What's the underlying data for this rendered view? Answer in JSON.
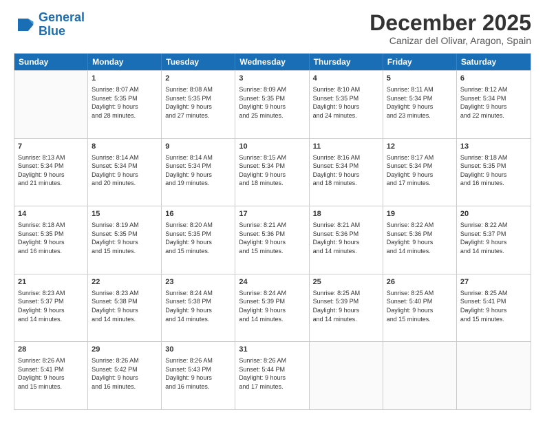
{
  "logo": {
    "line1": "General",
    "line2": "Blue"
  },
  "title": "December 2025",
  "location": "Canizar del Olivar, Aragon, Spain",
  "header_days": [
    "Sunday",
    "Monday",
    "Tuesday",
    "Wednesday",
    "Thursday",
    "Friday",
    "Saturday"
  ],
  "weeks": [
    [
      {
        "day": "",
        "info": ""
      },
      {
        "day": "1",
        "info": "Sunrise: 8:07 AM\nSunset: 5:35 PM\nDaylight: 9 hours\nand 28 minutes."
      },
      {
        "day": "2",
        "info": "Sunrise: 8:08 AM\nSunset: 5:35 PM\nDaylight: 9 hours\nand 27 minutes."
      },
      {
        "day": "3",
        "info": "Sunrise: 8:09 AM\nSunset: 5:35 PM\nDaylight: 9 hours\nand 25 minutes."
      },
      {
        "day": "4",
        "info": "Sunrise: 8:10 AM\nSunset: 5:35 PM\nDaylight: 9 hours\nand 24 minutes."
      },
      {
        "day": "5",
        "info": "Sunrise: 8:11 AM\nSunset: 5:34 PM\nDaylight: 9 hours\nand 23 minutes."
      },
      {
        "day": "6",
        "info": "Sunrise: 8:12 AM\nSunset: 5:34 PM\nDaylight: 9 hours\nand 22 minutes."
      }
    ],
    [
      {
        "day": "7",
        "info": "Sunrise: 8:13 AM\nSunset: 5:34 PM\nDaylight: 9 hours\nand 21 minutes."
      },
      {
        "day": "8",
        "info": "Sunrise: 8:14 AM\nSunset: 5:34 PM\nDaylight: 9 hours\nand 20 minutes."
      },
      {
        "day": "9",
        "info": "Sunrise: 8:14 AM\nSunset: 5:34 PM\nDaylight: 9 hours\nand 19 minutes."
      },
      {
        "day": "10",
        "info": "Sunrise: 8:15 AM\nSunset: 5:34 PM\nDaylight: 9 hours\nand 18 minutes."
      },
      {
        "day": "11",
        "info": "Sunrise: 8:16 AM\nSunset: 5:34 PM\nDaylight: 9 hours\nand 18 minutes."
      },
      {
        "day": "12",
        "info": "Sunrise: 8:17 AM\nSunset: 5:34 PM\nDaylight: 9 hours\nand 17 minutes."
      },
      {
        "day": "13",
        "info": "Sunrise: 8:18 AM\nSunset: 5:35 PM\nDaylight: 9 hours\nand 16 minutes."
      }
    ],
    [
      {
        "day": "14",
        "info": "Sunrise: 8:18 AM\nSunset: 5:35 PM\nDaylight: 9 hours\nand 16 minutes."
      },
      {
        "day": "15",
        "info": "Sunrise: 8:19 AM\nSunset: 5:35 PM\nDaylight: 9 hours\nand 15 minutes."
      },
      {
        "day": "16",
        "info": "Sunrise: 8:20 AM\nSunset: 5:35 PM\nDaylight: 9 hours\nand 15 minutes."
      },
      {
        "day": "17",
        "info": "Sunrise: 8:21 AM\nSunset: 5:36 PM\nDaylight: 9 hours\nand 15 minutes."
      },
      {
        "day": "18",
        "info": "Sunrise: 8:21 AM\nSunset: 5:36 PM\nDaylight: 9 hours\nand 14 minutes."
      },
      {
        "day": "19",
        "info": "Sunrise: 8:22 AM\nSunset: 5:36 PM\nDaylight: 9 hours\nand 14 minutes."
      },
      {
        "day": "20",
        "info": "Sunrise: 8:22 AM\nSunset: 5:37 PM\nDaylight: 9 hours\nand 14 minutes."
      }
    ],
    [
      {
        "day": "21",
        "info": "Sunrise: 8:23 AM\nSunset: 5:37 PM\nDaylight: 9 hours\nand 14 minutes."
      },
      {
        "day": "22",
        "info": "Sunrise: 8:23 AM\nSunset: 5:38 PM\nDaylight: 9 hours\nand 14 minutes."
      },
      {
        "day": "23",
        "info": "Sunrise: 8:24 AM\nSunset: 5:38 PM\nDaylight: 9 hours\nand 14 minutes."
      },
      {
        "day": "24",
        "info": "Sunrise: 8:24 AM\nSunset: 5:39 PM\nDaylight: 9 hours\nand 14 minutes."
      },
      {
        "day": "25",
        "info": "Sunrise: 8:25 AM\nSunset: 5:39 PM\nDaylight: 9 hours\nand 14 minutes."
      },
      {
        "day": "26",
        "info": "Sunrise: 8:25 AM\nSunset: 5:40 PM\nDaylight: 9 hours\nand 15 minutes."
      },
      {
        "day": "27",
        "info": "Sunrise: 8:25 AM\nSunset: 5:41 PM\nDaylight: 9 hours\nand 15 minutes."
      }
    ],
    [
      {
        "day": "28",
        "info": "Sunrise: 8:26 AM\nSunset: 5:41 PM\nDaylight: 9 hours\nand 15 minutes."
      },
      {
        "day": "29",
        "info": "Sunrise: 8:26 AM\nSunset: 5:42 PM\nDaylight: 9 hours\nand 16 minutes."
      },
      {
        "day": "30",
        "info": "Sunrise: 8:26 AM\nSunset: 5:43 PM\nDaylight: 9 hours\nand 16 minutes."
      },
      {
        "day": "31",
        "info": "Sunrise: 8:26 AM\nSunset: 5:44 PM\nDaylight: 9 hours\nand 17 minutes."
      },
      {
        "day": "",
        "info": ""
      },
      {
        "day": "",
        "info": ""
      },
      {
        "day": "",
        "info": ""
      }
    ]
  ]
}
